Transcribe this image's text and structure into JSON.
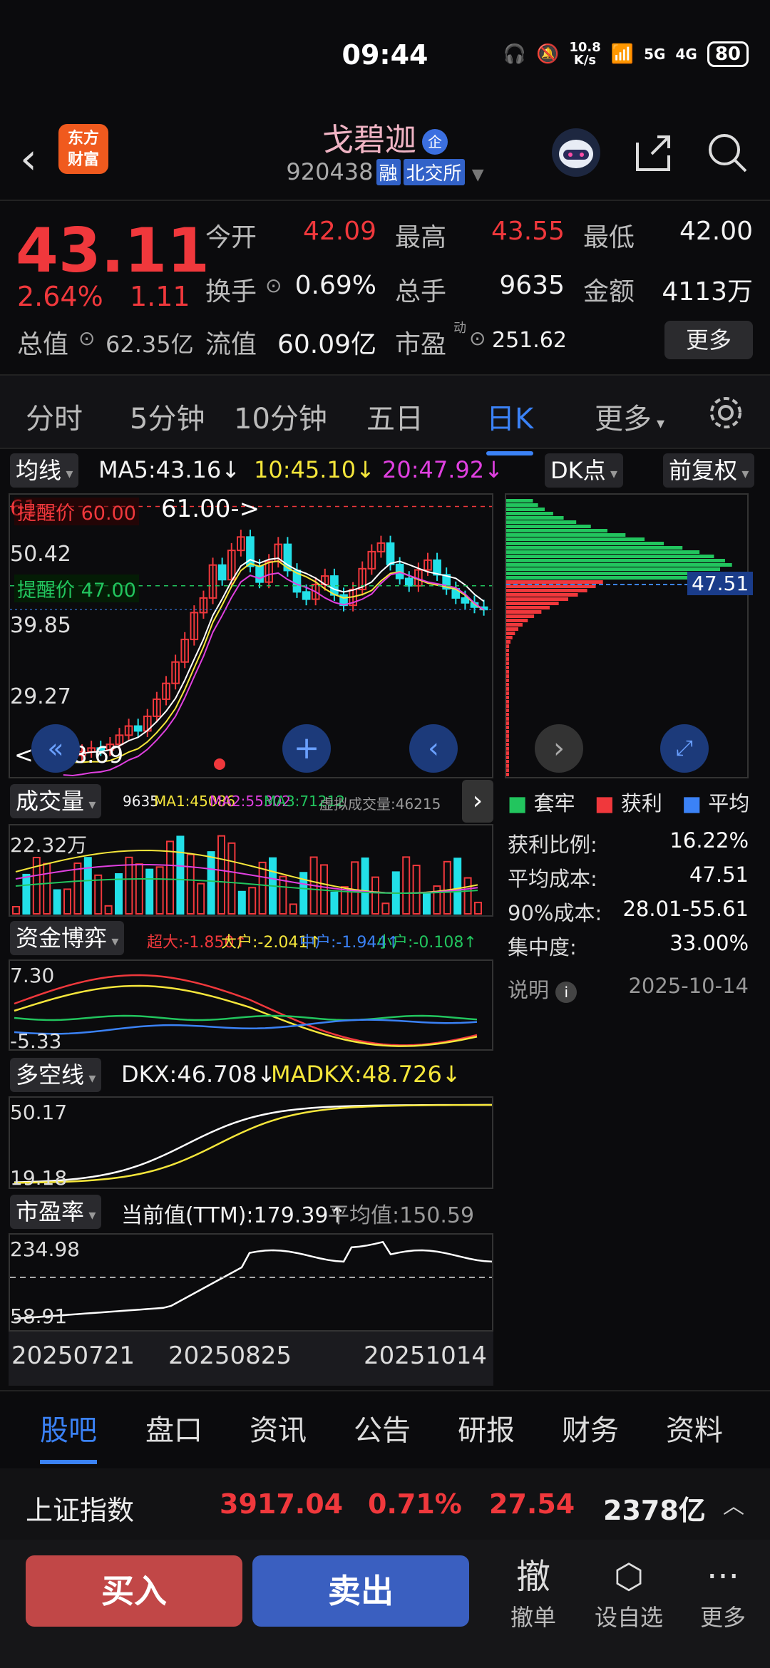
{
  "status": {
    "time": "09:44",
    "net_speed_top": "10.8",
    "net_speed_unit": "K/s",
    "battery": "80",
    "sig1": "5G",
    "sig2": "4G"
  },
  "header": {
    "logo_line1": "东方",
    "logo_line2": "财富",
    "name": "戈碧迦",
    "name_badge": "企",
    "code": "920438",
    "tag_margin": "融",
    "tag_exchange": "北交所"
  },
  "quote": {
    "price": "43.11",
    "change_pct": "2.64%",
    "change_amt": "1.11",
    "open_label": "今开",
    "open": "42.09",
    "high_label": "最高",
    "high": "43.55",
    "low_label": "最低",
    "low": "42.00",
    "turnover_label": "换手",
    "turnover": "0.69%",
    "vol_label": "总手",
    "vol": "9635",
    "amount_label": "金额",
    "amount": "4113万",
    "mcap_label": "总值",
    "mcap": "62.35亿",
    "float_label": "流值",
    "float": "60.09亿",
    "pe_label": "市盈",
    "pe_sup": "动",
    "pe": "251.62",
    "more": "更多"
  },
  "tabs": [
    "分时",
    "5分钟",
    "10分钟",
    "五日",
    "日K",
    "更多"
  ],
  "kline": {
    "ma_select": "均线",
    "ma5": "MA5:43.16↓",
    "ma10": "10:45.10↓",
    "ma20": "20:47.92↓",
    "dk_btn": "DK点",
    "adjust_btn": "前复权",
    "alert_high": "提醒价 60.00",
    "alert_high_val": "60.00",
    "alert_low": "提醒价 47.00",
    "max_label": "61.00->",
    "min_label": "<---18.69",
    "y_labels": [
      "50.42",
      "39.85",
      "29.27",
      "18.69"
    ],
    "y_top": "61"
  },
  "chips": {
    "avg_label": "47.51",
    "legend": [
      "套牢",
      "获利",
      "平均"
    ],
    "stats": [
      {
        "label": "获利比例:",
        "value": "16.22%"
      },
      {
        "label": "平均成本:",
        "value": "47.51"
      },
      {
        "label": "90%成本:",
        "value": "28.01-55.61"
      },
      {
        "label": "集中度:",
        "value": "33.00%"
      }
    ],
    "note": "说明",
    "date": "2025-10-14"
  },
  "volume": {
    "select": "成交量",
    "v": "9635",
    "ma1": "MA1:45086",
    "ma2": "MA2:55302",
    "ma3": "MA3:71212",
    "virtual": "虚拟成交量:46215",
    "y_top": "22.32万"
  },
  "capital": {
    "select": "资金博弈",
    "super": "超大:-1.850↑",
    "big": "大户:-2.041↑",
    "mid": "中户:-1.944↑",
    "small": "小户:-0.108↑",
    "y_top": "7.30",
    "y_bot": "-5.33"
  },
  "dkx": {
    "select": "多空线",
    "dkx": "DKX:46.708↓",
    "madkx": "MADKX:48.726↓",
    "y_top": "50.17",
    "y_bot": "19.18"
  },
  "pe_panel": {
    "select": "市盈率",
    "current": "当前值(TTM):179.39↑",
    "avg": "平均值:150.59",
    "y_top": "234.98",
    "y_bot": "58.91"
  },
  "dates": [
    "20250721",
    "20250825",
    "20251014"
  ],
  "bottom_tabs": [
    "股吧",
    "盘口",
    "资讯",
    "公告",
    "研报",
    "财务",
    "资料"
  ],
  "index_bar": {
    "name": "上证指数",
    "value": "3917.04",
    "pct": "0.71%",
    "chg": "27.54",
    "amount": "2378亿"
  },
  "actions": {
    "buy": "买入",
    "sell": "卖出",
    "cancel_icon": "撤",
    "cancel": "撤单",
    "watch": "设自选",
    "more": "更多"
  },
  "colors": {
    "up": "#f0383c",
    "down": "#22e0e8",
    "accent": "#3b82f6",
    "ma5": "#ffffff",
    "ma10": "#f5e63b",
    "ma20": "#e040e0"
  }
}
